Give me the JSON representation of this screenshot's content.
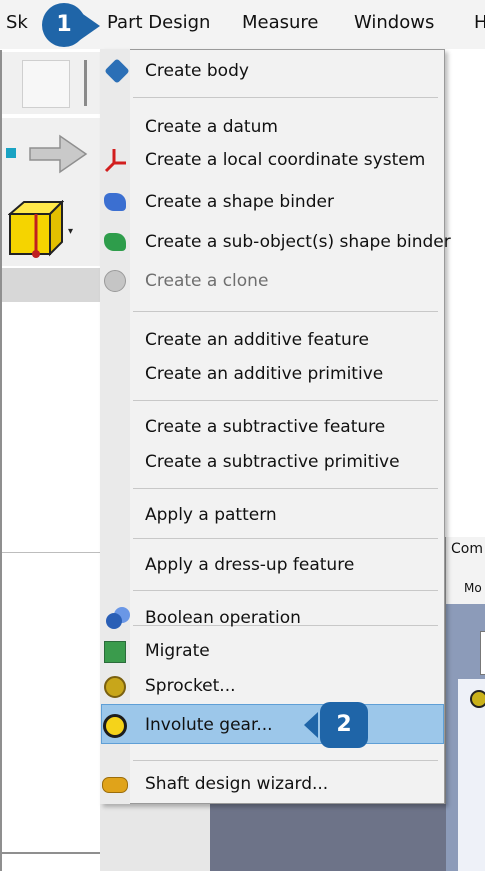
{
  "menubar": {
    "items": [
      {
        "label": "Sk"
      },
      {
        "label": "Part Design"
      },
      {
        "label": "Measure"
      },
      {
        "label": "Windows"
      },
      {
        "label": "H"
      }
    ]
  },
  "combo_view": {
    "title": "Com",
    "model_tab": "Mo"
  },
  "part_design_menu": {
    "items": [
      {
        "label": "Create body",
        "icon": "body-icon"
      },
      {
        "label": "Create a datum",
        "icon": null
      },
      {
        "label": "Create a local coordinate system",
        "icon": "coordinate-system-icon"
      },
      {
        "label": "Create a shape binder",
        "icon": "shape-binder-icon"
      },
      {
        "label": "Create a sub-object(s) shape binder",
        "icon": "subshape-binder-icon"
      },
      {
        "label": "Create a clone",
        "icon": "clone-icon",
        "disabled": true
      },
      {
        "label": "Create an additive feature",
        "icon": null
      },
      {
        "label": "Create an additive primitive",
        "icon": null
      },
      {
        "label": "Create a subtractive feature",
        "icon": null
      },
      {
        "label": "Create a subtractive primitive",
        "icon": null
      },
      {
        "label": "Apply a pattern",
        "icon": null
      },
      {
        "label": "Apply a dress-up feature",
        "icon": null
      },
      {
        "label": "Boolean operation",
        "icon": "boolean-icon"
      },
      {
        "label": "Migrate",
        "icon": "migrate-icon"
      },
      {
        "label": "Sprocket...",
        "icon": "sprocket-icon"
      },
      {
        "label": "Involute gear...",
        "icon": "involute-gear-icon",
        "highlighted": true
      },
      {
        "label": "Shaft design wizard...",
        "icon": "shaft-icon"
      }
    ]
  },
  "callouts": {
    "step1": "1",
    "step2": "2"
  },
  "colors": {
    "accent": "#1f65a8",
    "highlight": "#9cc7ea"
  }
}
